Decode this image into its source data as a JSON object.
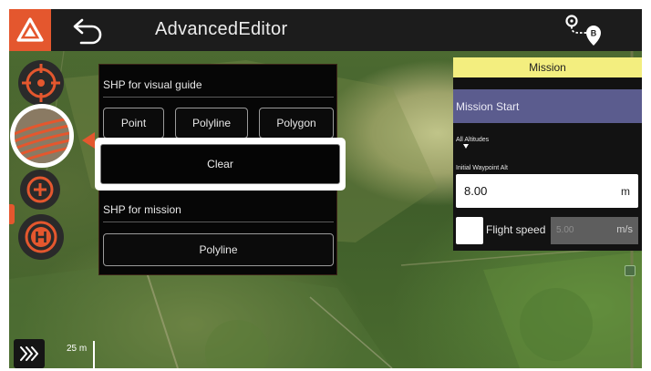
{
  "app": {
    "title": "AdvancedEditor"
  },
  "topbar": {
    "logo_icon": "triangle-logo-icon",
    "back_icon": "back-arrow-icon",
    "route_icon": "route-pin-icon"
  },
  "tools": {
    "target_icon": "crosshair-icon",
    "field_icon": "field-rows-icon",
    "add_icon": "plus-icon",
    "home_icon": "h-landing-icon"
  },
  "shp_panel": {
    "visual_guide_title": "SHP for visual guide",
    "point_label": "Point",
    "polyline_label": "Polyline",
    "polygon_label": "Polygon",
    "clear_label": "Clear",
    "mission_title": "SHP for mission",
    "mission_polyline_label": "Polyline"
  },
  "mission": {
    "header": "Mission",
    "start_label": "Mission Start",
    "altitudes_label": "All Altitudes",
    "initial_alt_label": "Initial Waypoint Alt",
    "initial_alt_value": "8.00",
    "initial_alt_unit": "m",
    "flight_speed_label": "Flight speed",
    "flight_speed_value": "5.00",
    "flight_speed_unit": "m/s"
  },
  "map": {
    "scale_label": "25 m",
    "expand_icon": "chevrons-right-icon"
  },
  "colors": {
    "accent": "#e4572e",
    "topbar": "#1c1c1c",
    "mission_header": "#f3ee7f",
    "mission_start": "#5b5c8e"
  }
}
